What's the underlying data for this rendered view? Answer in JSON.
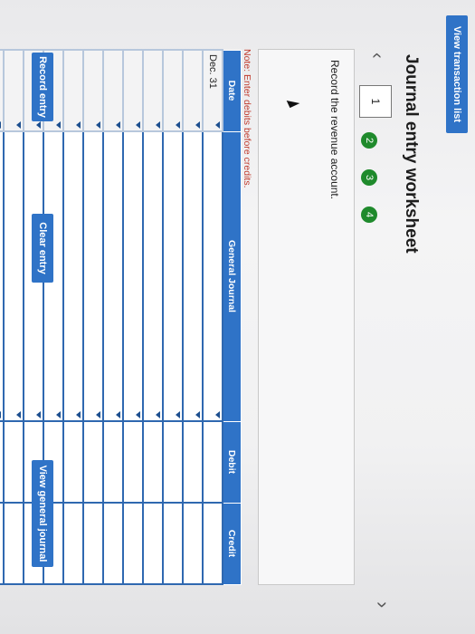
{
  "header": {
    "view_transactions_label": "View transaction list"
  },
  "worksheet": {
    "title": "Journal entry worksheet",
    "prev_icon": "chevron-left-icon",
    "next_icon": "chevron-right-icon",
    "steps": [
      "1",
      "2",
      "3",
      "4"
    ],
    "active_step": "1",
    "instruction": "Record the revenue account.",
    "note": "Note: Enter debits before credits."
  },
  "table": {
    "columns": [
      "Date",
      "General Journal",
      "Debit",
      "Credit"
    ],
    "rows": [
      {
        "date": "Dec. 31",
        "account": "",
        "debit": "",
        "credit": ""
      },
      {
        "date": "",
        "account": "",
        "debit": "",
        "credit": ""
      },
      {
        "date": "",
        "account": "",
        "debit": "",
        "credit": ""
      },
      {
        "date": "",
        "account": "",
        "debit": "",
        "credit": ""
      },
      {
        "date": "",
        "account": "",
        "debit": "",
        "credit": ""
      },
      {
        "date": "",
        "account": "",
        "debit": "",
        "credit": ""
      },
      {
        "date": "",
        "account": "",
        "debit": "",
        "credit": ""
      },
      {
        "date": "",
        "account": "",
        "debit": "",
        "credit": ""
      },
      {
        "date": "",
        "account": "",
        "debit": "",
        "credit": ""
      },
      {
        "date": "",
        "account": "",
        "debit": "",
        "credit": ""
      },
      {
        "date": "",
        "account": "",
        "debit": "",
        "credit": ""
      },
      {
        "date": "",
        "account": "",
        "debit": "",
        "credit": ""
      },
      {
        "date": "",
        "account": "",
        "debit": "",
        "credit": ""
      }
    ]
  },
  "actions": {
    "record_label": "Record entry",
    "clear_label": "Clear entry",
    "view_journal_label": "View general journal"
  },
  "colors": {
    "accent": "#2f73c7",
    "step_green": "#1f8a2c",
    "note_red": "#c0392b"
  }
}
